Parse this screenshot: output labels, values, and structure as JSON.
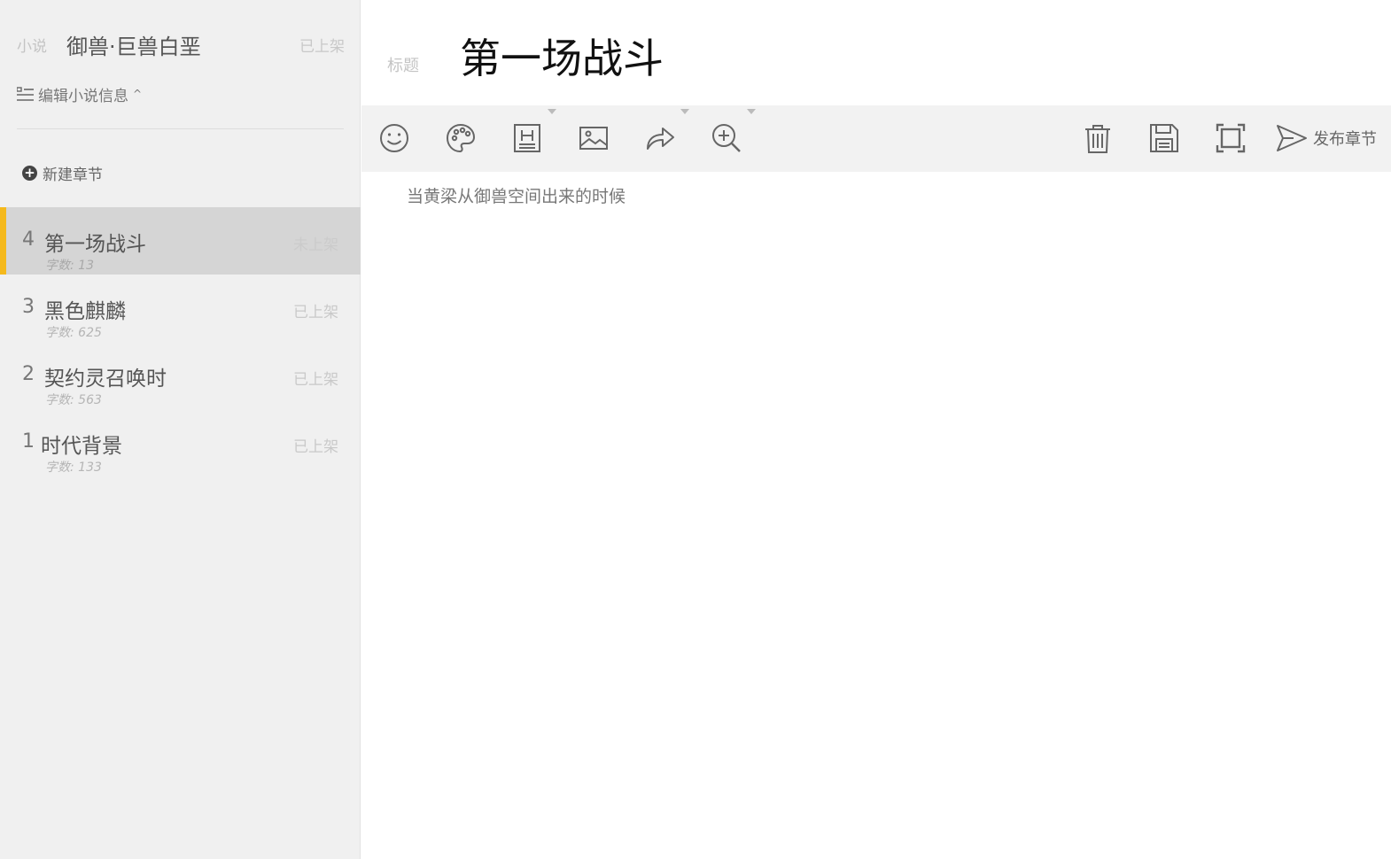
{
  "sidebar": {
    "novel_label": "小说",
    "novel_title": "御兽·巨兽白垩",
    "novel_status": "已上架",
    "edit_info_label": "编辑小说信息",
    "new_chapter_label": "新建章节",
    "chapters": [
      {
        "num": "4",
        "title": "第一场战斗",
        "words": "字数: 13",
        "status": "未上架",
        "active": true
      },
      {
        "num": "3",
        "title": "黑色麒麟",
        "words": "字数: 625",
        "status": "已上架",
        "active": false
      },
      {
        "num": "2",
        "title": "契约灵召唤时",
        "words": "字数: 563",
        "status": "已上架",
        "active": false
      },
      {
        "num": "1",
        "title": "时代背景",
        "words": "字数: 133",
        "status": "已上架",
        "active": false
      }
    ]
  },
  "editor": {
    "title_label": "标题",
    "title_value": "第一场战斗",
    "content": "当黄梁从御兽空间出来的时候",
    "publish_label": "发布章节"
  },
  "toolbar_icons": [
    "smiley-icon",
    "palette-icon",
    "heading-icon",
    "image-icon",
    "redo-icon",
    "zoom-in-icon",
    "trash-icon",
    "save-icon",
    "fullscreen-icon",
    "send-icon"
  ],
  "colors": {
    "accent": "#f5b91c",
    "sidebar_bg": "#f0f0f0",
    "active_item_bg": "#d5d5d5",
    "toolbar_bg": "#f2f2f2"
  }
}
